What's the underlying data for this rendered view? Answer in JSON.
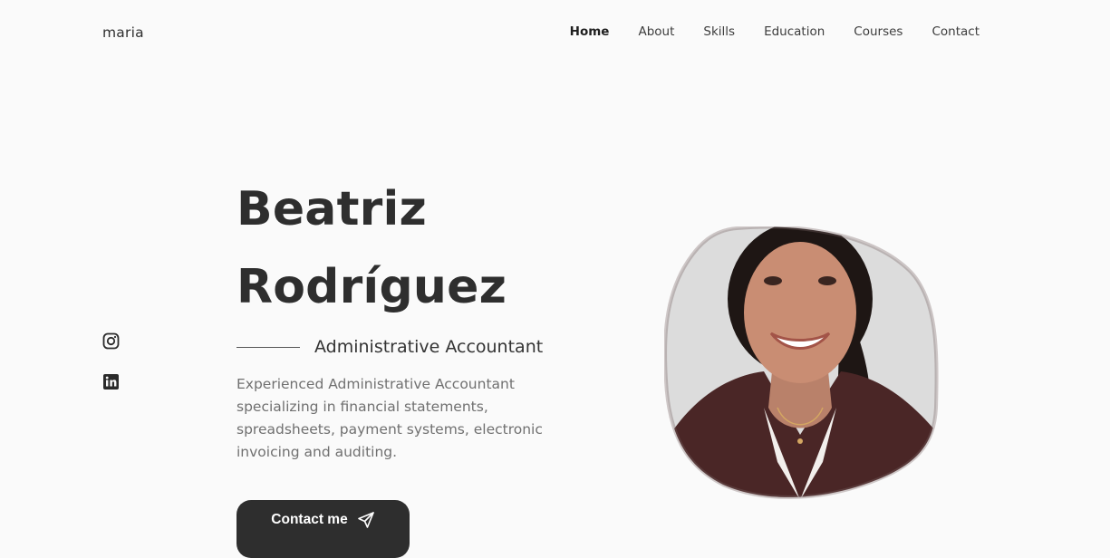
{
  "header": {
    "logo": "maria",
    "nav": [
      {
        "label": "Home",
        "active": true
      },
      {
        "label": "About",
        "active": false
      },
      {
        "label": "Skills",
        "active": false
      },
      {
        "label": "Education",
        "active": false
      },
      {
        "label": "Courses",
        "active": false
      },
      {
        "label": "Contact",
        "active": false
      }
    ]
  },
  "social": [
    {
      "icon": "instagram-icon"
    },
    {
      "icon": "linkedin-icon"
    }
  ],
  "hero": {
    "first_name": "Beatriz",
    "last_name": "Rodríguez",
    "subtitle": "Administrative Accountant",
    "description": "Experienced Administrative Accountant specializing in financial statements, spreadsheets, payment systems, electronic invoicing and auditing.",
    "cta_label": "Contact me",
    "cta_icon": "send-icon"
  },
  "colors": {
    "background": "#fafafa",
    "text": "#333333",
    "button": "#2e2e2e",
    "blazer": "#4a2626"
  }
}
